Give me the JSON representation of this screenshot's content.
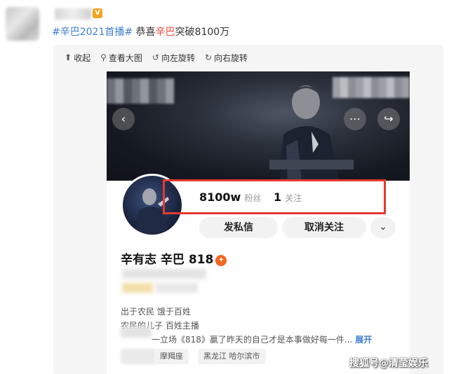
{
  "post": {
    "vip_badge": "V",
    "hashtag": "#辛巴2021首播#",
    "text_before": " 恭喜",
    "highlight": "辛巴",
    "text_after": "突破8100万"
  },
  "toolbar": {
    "items": [
      {
        "icon": "collapse-icon",
        "glyph": "⬆",
        "label": "收起"
      },
      {
        "icon": "magnifier-icon",
        "glyph": "⚲",
        "label": "查看大图"
      },
      {
        "icon": "rotate-left-icon",
        "glyph": "↺",
        "label": "向左旋转"
      },
      {
        "icon": "rotate-right-icon",
        "glyph": "↻",
        "label": "向右旋转"
      }
    ]
  },
  "profile": {
    "followers_value": "8100w",
    "followers_label": "粉丝",
    "following_value": "1",
    "following_label": "关注",
    "message_button": "发私信",
    "unfollow_button": "取消关注",
    "more_glyph": "⌄",
    "name": "辛有志 辛巴 818",
    "bio_line1": "出于农民 饿于百姓",
    "bio_line2": "农民的儿子  百姓主播",
    "bio_line3": "一立场《818》赢了昨天的自己才是本事做好每一件...",
    "expand_label": "展开",
    "tags": [
      "摩羯座",
      "黑龙江 哈尔滨市"
    ]
  },
  "watermark": "搜狐号@清莹娱乐",
  "colors": {
    "hashtag": "#3c7ed6",
    "highlight": "#e8483b",
    "annotation_box": "#e53a30",
    "expand_link": "#3c7ed6"
  }
}
